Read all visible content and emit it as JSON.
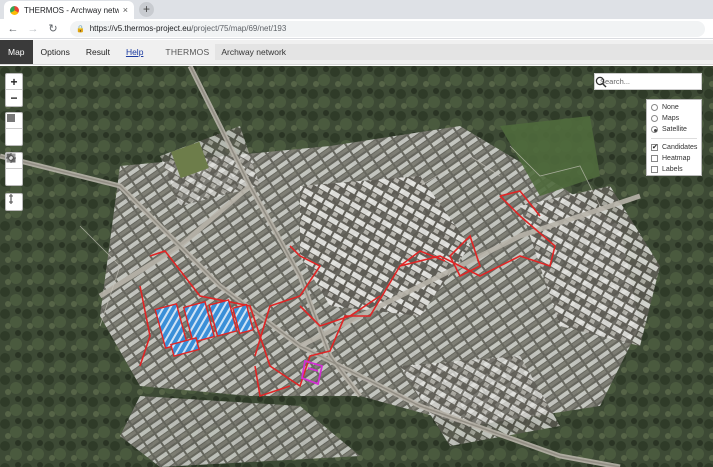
{
  "browser": {
    "tab_title": "THERMOS - Archway network",
    "tab_close": "×",
    "new_tab": "+",
    "back": "←",
    "forward": "→",
    "reload": "↻",
    "url_host": "https://v5.thermos-project.eu",
    "url_path": "/project/75/map/69/net/193"
  },
  "appbar": {
    "items": [
      "Map",
      "Options",
      "Result",
      "Help"
    ],
    "brand": "THERMOS",
    "network_name": "Archway network"
  },
  "map": {
    "zoom_in": "+",
    "zoom_out": "−",
    "search_placeholder": "Search...",
    "basemap_options": [
      {
        "label": "None",
        "selected": false
      },
      {
        "label": "Maps",
        "selected": false
      },
      {
        "label": "Satellite",
        "selected": true
      }
    ],
    "overlay_options": [
      {
        "label": "Candidates",
        "checked": true
      },
      {
        "label": "Heatmap",
        "checked": false
      },
      {
        "label": "Labels",
        "checked": false
      }
    ],
    "colors": {
      "imagery_base": "#3e4a36",
      "candidate_outline": "#e02525",
      "selected_fill": "#3a8fd8",
      "highlight": "#d230d2"
    }
  }
}
